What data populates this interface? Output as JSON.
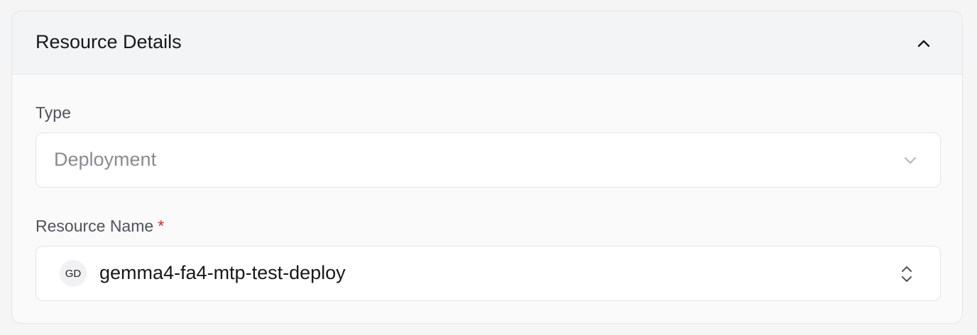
{
  "card": {
    "title": "Resource Details",
    "collapse_icon": "chevron-up-icon"
  },
  "type_field": {
    "label": "Type",
    "value": "Deployment",
    "disabled": true,
    "icon": "chevron-down-icon"
  },
  "resource_field": {
    "label": "Resource Name",
    "required_marker": "*",
    "avatar_initials": "GD",
    "value": "gemma4-fa4-mtp-test-deploy",
    "icon": "chevron-up-down-icon"
  },
  "colors": {
    "required": "#dc2626",
    "header_bg": "#f3f4f6",
    "border": "#e4e4e7"
  }
}
